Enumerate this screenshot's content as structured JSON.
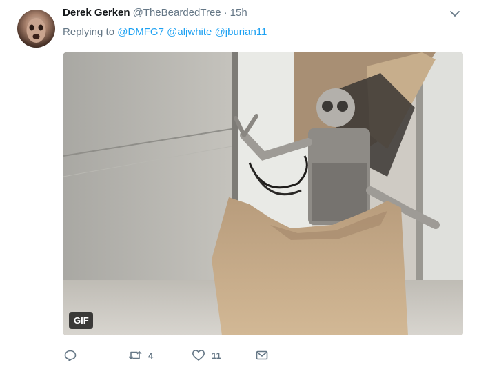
{
  "tweet": {
    "display_name": "Derek Gerken",
    "handle": "@TheBeardedTree",
    "separator": "·",
    "time": "15h",
    "replying_prefix": "Replying to",
    "mentions": [
      "@DMFG7",
      "@aljwhite",
      "@jburian11"
    ],
    "media": {
      "badge": "GIF"
    },
    "actions": {
      "reply_count": "",
      "retweet_count": "4",
      "like_count": "11"
    }
  },
  "colors": {
    "link": "#1da1f2",
    "secondary_text": "#657786",
    "primary_text": "#14171a"
  },
  "icons": [
    "chevron-down-icon",
    "reply-icon",
    "retweet-icon",
    "like-icon",
    "direct-message-icon"
  ]
}
